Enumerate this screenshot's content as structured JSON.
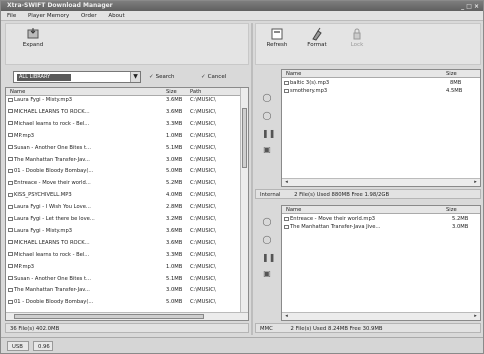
{
  "window": {
    "title": "Xtra-SWIFT Download Manager",
    "controls": "_ □ ×"
  },
  "menu": [
    "File",
    "Player Memory",
    "Order",
    "About"
  ],
  "toolbar_left": {
    "expand_label": "Expand"
  },
  "toolbar_right": {
    "refresh_label": "Refresh",
    "format_label": "Format",
    "lock_label": "Lock"
  },
  "filter": {
    "combo_value": "ALL LIBRARY",
    "search_label": "Search",
    "cancel_label": "Cancel"
  },
  "library": {
    "columns": {
      "name": "Name",
      "size": "Size",
      "path": "Path"
    },
    "rows": [
      {
        "name": "Laura Fygi - Misty.mp3",
        "size": "3.6MB",
        "path": "C:\\MUSIC\\"
      },
      {
        "name": "MICHAEL LEARNS TO ROCK...",
        "size": "3.6MB",
        "path": "C:\\MUSIC\\"
      },
      {
        "name": "Michael learns to rock - Bel...",
        "size": "3.3MB",
        "path": "C:\\MUSIC\\"
      },
      {
        "name": "MP.mp3",
        "size": "1.0MB",
        "path": "C:\\MUSIC\\"
      },
      {
        "name": "Susan - Another One Bites t...",
        "size": "5.1MB",
        "path": "C:\\MUSIC\\"
      },
      {
        "name": "The Manhattan Transfer-Jav...",
        "size": "3.0MB",
        "path": "C:\\MUSIC\\"
      },
      {
        "name": "01 - Doobie Bloody Bombay(...",
        "size": "5.0MB",
        "path": "C:\\MUSIC\\"
      },
      {
        "name": "Entreace - Move their world...",
        "size": "5.2MB",
        "path": "C:\\MUSIC\\"
      },
      {
        "name": "KISS_PSYCHIVELL.MP3",
        "size": "4.0MB",
        "path": "C:\\MUSIC\\"
      },
      {
        "name": "Laura Fygi - I Wish You Love...",
        "size": "2.8MB",
        "path": "C:\\MUSIC\\"
      },
      {
        "name": "Laura Fygi - Let there be love...",
        "size": "3.2MB",
        "path": "C:\\MUSIC\\"
      },
      {
        "name": "Laura Fygi - Misty.mp3",
        "size": "3.6MB",
        "path": "C:\\MUSIC\\"
      },
      {
        "name": "MICHAEL LEARNS TO ROCK...",
        "size": "3.6MB",
        "path": "C:\\MUSIC\\"
      },
      {
        "name": "Michael learns to rock - Bel...",
        "size": "3.3MB",
        "path": "C:\\MUSIC\\"
      },
      {
        "name": "MP.mp3",
        "size": "1.0MB",
        "path": "C:\\MUSIC\\"
      },
      {
        "name": "Susan - Another One Bites t...",
        "size": "5.1MB",
        "path": "C:\\MUSIC\\"
      },
      {
        "name": "The Manhattan Transfer-Jav...",
        "size": "3.0MB",
        "path": "C:\\MUSIC\\"
      },
      {
        "name": "01 - Doobie Bloody Bombay(...",
        "size": "5.0MB",
        "path": "C:\\MUSIC\\"
      }
    ]
  },
  "library_status": "36 File(s) 402.0MB",
  "upper_device": {
    "columns": {
      "name": "Name",
      "size": "Size"
    },
    "rows": [
      {
        "name": "baltic 3(s).mp3",
        "size": "8MB"
      },
      {
        "name": "smothery.mp3",
        "size": "4.5MB"
      }
    ],
    "status_tag": "Internal",
    "status": "2 File(s)  Used 880MB  Free 1.98/2GB"
  },
  "lower_device": {
    "columns": {
      "name": "Name",
      "size": "Size"
    },
    "rows": [
      {
        "name": "Entreace - Move their world.mp3",
        "size": "5.2MB"
      },
      {
        "name": "The Manhattan Transfer-Java Jive...",
        "size": "3.0MB"
      }
    ],
    "status_tag": "MMC",
    "status": "2 File(s)  Used 8.24MB  Free 30.9MB"
  },
  "bottom_bar": [
    "USB",
    "0.96"
  ]
}
